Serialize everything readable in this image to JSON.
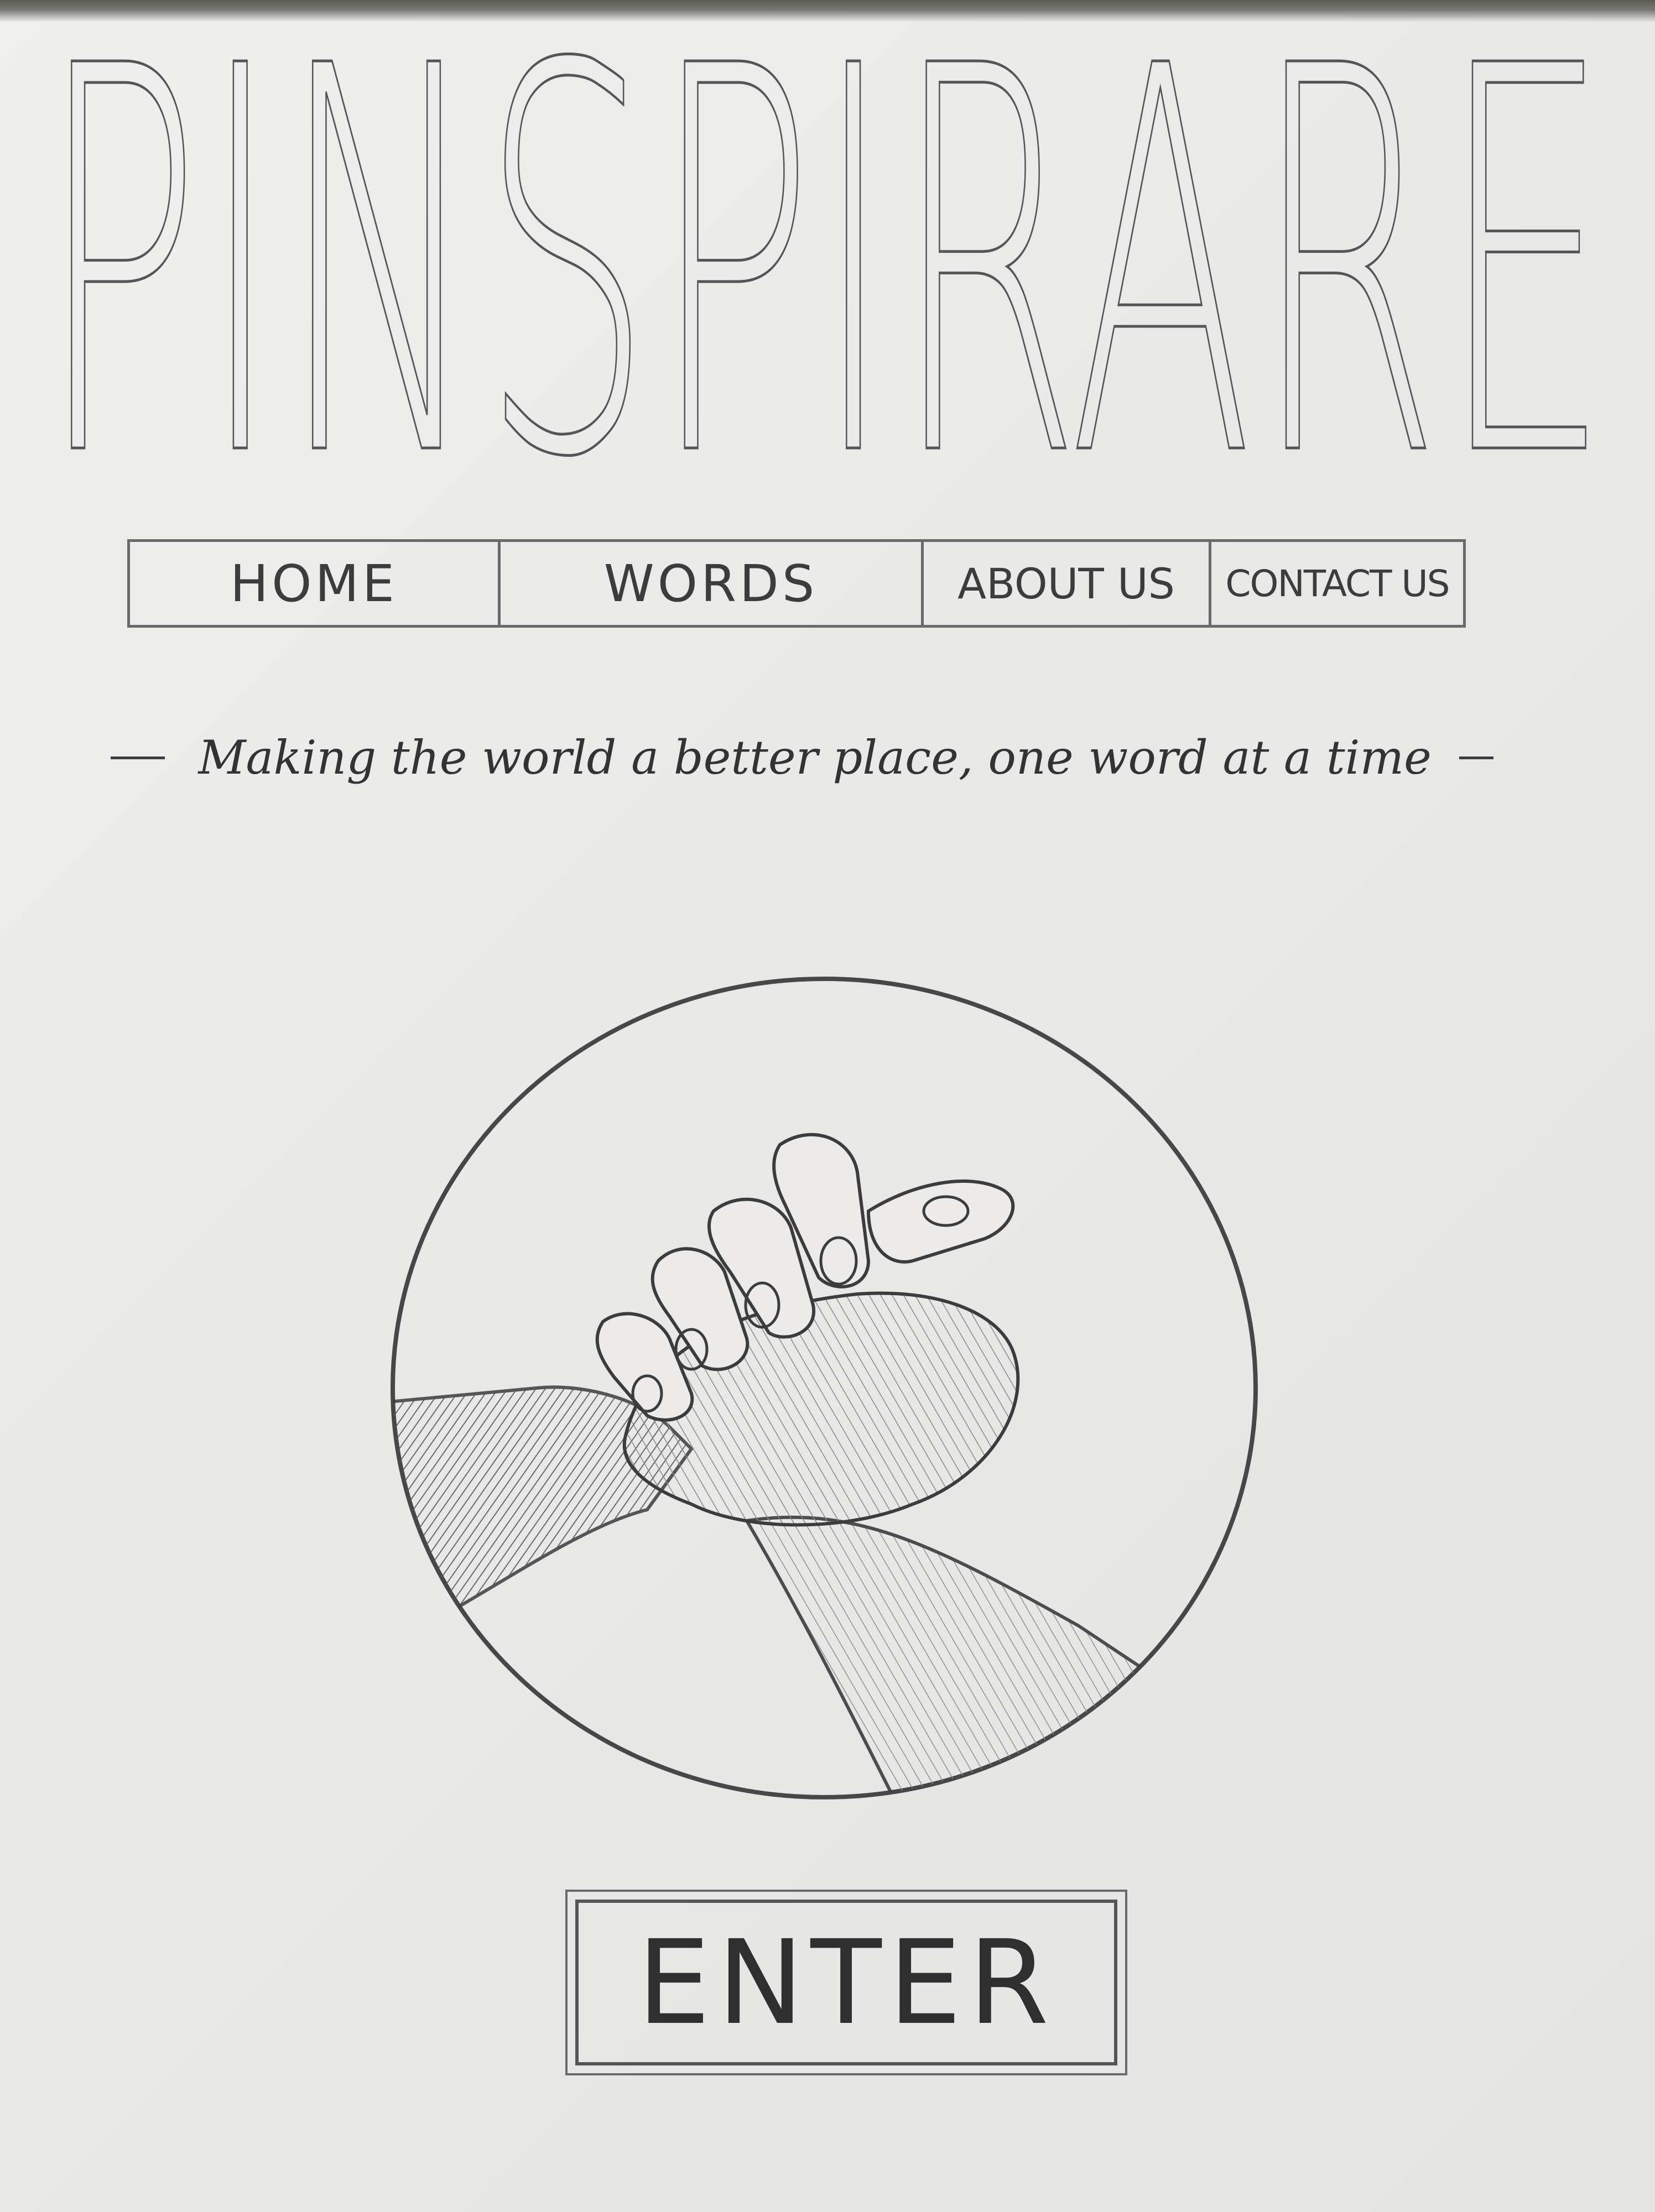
{
  "site": {
    "logo_text": "PINSPIRARE"
  },
  "nav": {
    "items": [
      {
        "label": "HOME"
      },
      {
        "label": "WORDS"
      },
      {
        "label": "ABOUT US"
      },
      {
        "label": "CONTACT US"
      }
    ]
  },
  "hero": {
    "tagline": "Making the world a better place, one word at a time",
    "illustration_icon": "clasped-hands-icon"
  },
  "cta": {
    "enter_label": "ENTER"
  },
  "colors": {
    "paper": "#ecebea",
    "pencil": "#3c3c3c"
  }
}
